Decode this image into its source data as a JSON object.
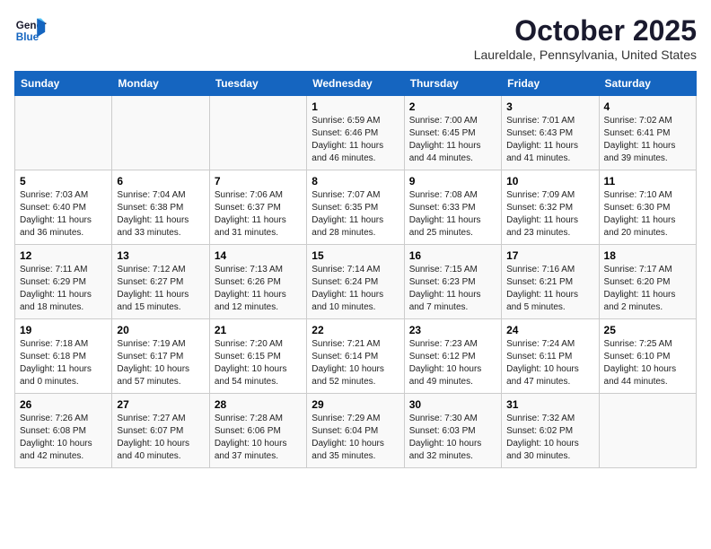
{
  "header": {
    "logo_general": "General",
    "logo_blue": "Blue",
    "month": "October 2025",
    "location": "Laureldale, Pennsylvania, United States"
  },
  "weekdays": [
    "Sunday",
    "Monday",
    "Tuesday",
    "Wednesday",
    "Thursday",
    "Friday",
    "Saturday"
  ],
  "rows": [
    [
      {
        "day": "",
        "info": ""
      },
      {
        "day": "",
        "info": ""
      },
      {
        "day": "",
        "info": ""
      },
      {
        "day": "1",
        "info": "Sunrise: 6:59 AM\nSunset: 6:46 PM\nDaylight: 11 hours\nand 46 minutes."
      },
      {
        "day": "2",
        "info": "Sunrise: 7:00 AM\nSunset: 6:45 PM\nDaylight: 11 hours\nand 44 minutes."
      },
      {
        "day": "3",
        "info": "Sunrise: 7:01 AM\nSunset: 6:43 PM\nDaylight: 11 hours\nand 41 minutes."
      },
      {
        "day": "4",
        "info": "Sunrise: 7:02 AM\nSunset: 6:41 PM\nDaylight: 11 hours\nand 39 minutes."
      }
    ],
    [
      {
        "day": "5",
        "info": "Sunrise: 7:03 AM\nSunset: 6:40 PM\nDaylight: 11 hours\nand 36 minutes."
      },
      {
        "day": "6",
        "info": "Sunrise: 7:04 AM\nSunset: 6:38 PM\nDaylight: 11 hours\nand 33 minutes."
      },
      {
        "day": "7",
        "info": "Sunrise: 7:06 AM\nSunset: 6:37 PM\nDaylight: 11 hours\nand 31 minutes."
      },
      {
        "day": "8",
        "info": "Sunrise: 7:07 AM\nSunset: 6:35 PM\nDaylight: 11 hours\nand 28 minutes."
      },
      {
        "day": "9",
        "info": "Sunrise: 7:08 AM\nSunset: 6:33 PM\nDaylight: 11 hours\nand 25 minutes."
      },
      {
        "day": "10",
        "info": "Sunrise: 7:09 AM\nSunset: 6:32 PM\nDaylight: 11 hours\nand 23 minutes."
      },
      {
        "day": "11",
        "info": "Sunrise: 7:10 AM\nSunset: 6:30 PM\nDaylight: 11 hours\nand 20 minutes."
      }
    ],
    [
      {
        "day": "12",
        "info": "Sunrise: 7:11 AM\nSunset: 6:29 PM\nDaylight: 11 hours\nand 18 minutes."
      },
      {
        "day": "13",
        "info": "Sunrise: 7:12 AM\nSunset: 6:27 PM\nDaylight: 11 hours\nand 15 minutes."
      },
      {
        "day": "14",
        "info": "Sunrise: 7:13 AM\nSunset: 6:26 PM\nDaylight: 11 hours\nand 12 minutes."
      },
      {
        "day": "15",
        "info": "Sunrise: 7:14 AM\nSunset: 6:24 PM\nDaylight: 11 hours\nand 10 minutes."
      },
      {
        "day": "16",
        "info": "Sunrise: 7:15 AM\nSunset: 6:23 PM\nDaylight: 11 hours\nand 7 minutes."
      },
      {
        "day": "17",
        "info": "Sunrise: 7:16 AM\nSunset: 6:21 PM\nDaylight: 11 hours\nand 5 minutes."
      },
      {
        "day": "18",
        "info": "Sunrise: 7:17 AM\nSunset: 6:20 PM\nDaylight: 11 hours\nand 2 minutes."
      }
    ],
    [
      {
        "day": "19",
        "info": "Sunrise: 7:18 AM\nSunset: 6:18 PM\nDaylight: 11 hours\nand 0 minutes."
      },
      {
        "day": "20",
        "info": "Sunrise: 7:19 AM\nSunset: 6:17 PM\nDaylight: 10 hours\nand 57 minutes."
      },
      {
        "day": "21",
        "info": "Sunrise: 7:20 AM\nSunset: 6:15 PM\nDaylight: 10 hours\nand 54 minutes."
      },
      {
        "day": "22",
        "info": "Sunrise: 7:21 AM\nSunset: 6:14 PM\nDaylight: 10 hours\nand 52 minutes."
      },
      {
        "day": "23",
        "info": "Sunrise: 7:23 AM\nSunset: 6:12 PM\nDaylight: 10 hours\nand 49 minutes."
      },
      {
        "day": "24",
        "info": "Sunrise: 7:24 AM\nSunset: 6:11 PM\nDaylight: 10 hours\nand 47 minutes."
      },
      {
        "day": "25",
        "info": "Sunrise: 7:25 AM\nSunset: 6:10 PM\nDaylight: 10 hours\nand 44 minutes."
      }
    ],
    [
      {
        "day": "26",
        "info": "Sunrise: 7:26 AM\nSunset: 6:08 PM\nDaylight: 10 hours\nand 42 minutes."
      },
      {
        "day": "27",
        "info": "Sunrise: 7:27 AM\nSunset: 6:07 PM\nDaylight: 10 hours\nand 40 minutes."
      },
      {
        "day": "28",
        "info": "Sunrise: 7:28 AM\nSunset: 6:06 PM\nDaylight: 10 hours\nand 37 minutes."
      },
      {
        "day": "29",
        "info": "Sunrise: 7:29 AM\nSunset: 6:04 PM\nDaylight: 10 hours\nand 35 minutes."
      },
      {
        "day": "30",
        "info": "Sunrise: 7:30 AM\nSunset: 6:03 PM\nDaylight: 10 hours\nand 32 minutes."
      },
      {
        "day": "31",
        "info": "Sunrise: 7:32 AM\nSunset: 6:02 PM\nDaylight: 10 hours\nand 30 minutes."
      },
      {
        "day": "",
        "info": ""
      }
    ]
  ]
}
